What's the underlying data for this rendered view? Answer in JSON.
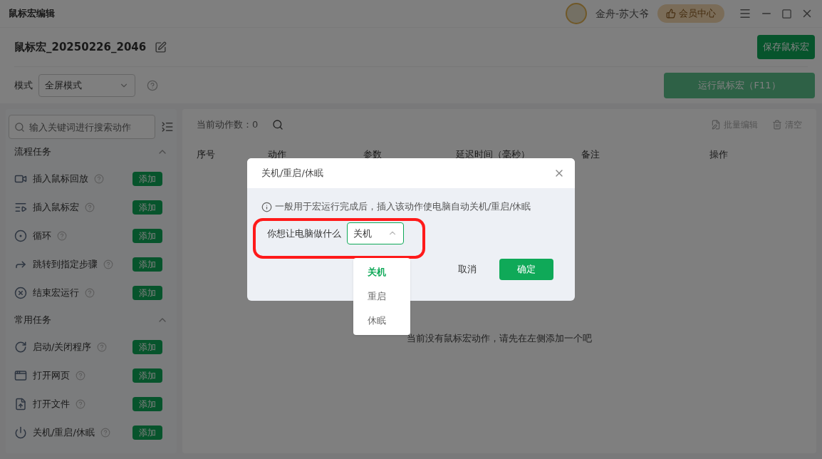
{
  "window": {
    "title": "鼠标宏编辑",
    "user_name": "金舟-苏大爷",
    "vip_button": "会员中心"
  },
  "macro": {
    "name": "鼠标宏_20250226_2046",
    "save_button": "保存鼠标宏"
  },
  "mode": {
    "label": "模式",
    "value": "全屏模式",
    "run_button": "运行鼠标宏（F11）",
    "run_disabled": true
  },
  "search": {
    "placeholder": "输入关键词进行搜索动作"
  },
  "sections": [
    {
      "title": "流程任务",
      "expanded": true,
      "items": [
        {
          "label": "插入鼠标回放",
          "kind": "video",
          "button": "添加"
        },
        {
          "label": "插入鼠标宏",
          "kind": "list",
          "button": "添加"
        },
        {
          "label": "循环",
          "kind": "loop",
          "button": "添加"
        },
        {
          "label": "跳转到指定步骤",
          "kind": "jump",
          "button": "添加"
        },
        {
          "label": "结束宏运行",
          "kind": "stop",
          "button": "添加"
        }
      ]
    },
    {
      "title": "常用任务",
      "expanded": true,
      "items": [
        {
          "label": "启动/关闭程序",
          "kind": "program",
          "button": "添加"
        },
        {
          "label": "打开网页",
          "kind": "webpage",
          "button": "添加"
        },
        {
          "label": "打开文件",
          "kind": "file",
          "button": "添加"
        },
        {
          "label": "关机/重启/休眠",
          "kind": "power",
          "button": "添加"
        }
      ]
    }
  ],
  "main": {
    "count_label": "当前动作数：0",
    "batch_edit": "批量编辑",
    "clear": "清空",
    "columns": [
      "序号",
      "动作",
      "参数",
      "延迟时间（毫秒）",
      "备注",
      "操作"
    ],
    "empty_text": "当前没有鼠标宏动作，请先在左侧添加一个吧"
  },
  "dialog": {
    "title": "关机/重启/休眠",
    "hint": "一般用于宏运行完成后，插入该动作使电脑自动关机/重启/休眠",
    "field_label": "你想让电脑做什么",
    "value": "关机",
    "open": true,
    "highlighted": true,
    "options": [
      {
        "label": "关机",
        "selected": true
      },
      {
        "label": "重启",
        "selected": false
      },
      {
        "label": "休眠",
        "selected": false
      }
    ],
    "cancel": "取消",
    "ok": "确定"
  }
}
